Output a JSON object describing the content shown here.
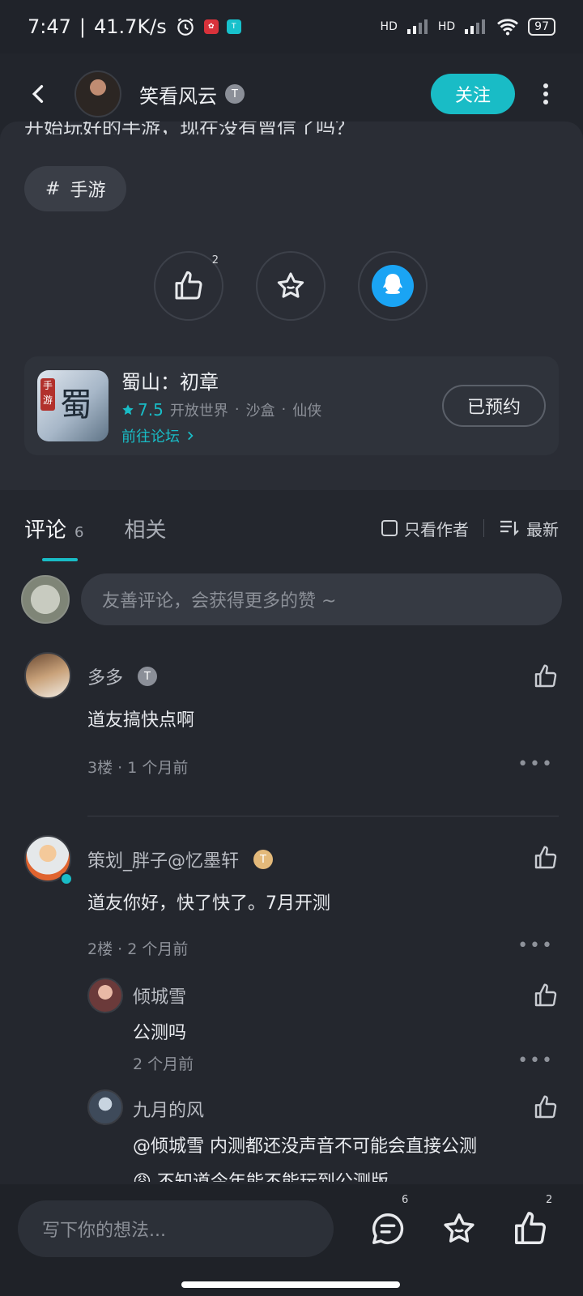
{
  "status_bar": {
    "time": "7:47",
    "speed": "41.7K/s",
    "battery": "97",
    "net1": "HD",
    "net2": "HD"
  },
  "header": {
    "author_name": "笑看风云",
    "badge": "T",
    "follow_label": "关注"
  },
  "post": {
    "cutoff_text": "开始玩好的手游，现在没有曾信了吗？",
    "tag": "手游",
    "like_count": "2"
  },
  "game": {
    "title": "蜀山：初章",
    "score": "7.5",
    "tags": [
      "开放世界",
      "沙盒",
      "仙侠"
    ],
    "link_label": "前往论坛",
    "reserved_label": "已预约",
    "icon_tag": "手游",
    "icon_glyph": "蜀"
  },
  "tabs": {
    "comment_label": "评论",
    "comment_count": "6",
    "related_label": "相关",
    "author_only_label": "只看作者",
    "sort_label": "最新"
  },
  "comment_input": {
    "placeholder": "友善评论，会获得更多的赞 ~"
  },
  "comments": [
    {
      "name": "多多",
      "badge": "T",
      "text": "道友搞快点啊",
      "meta": "3楼 · 1 个月前"
    },
    {
      "name": "策划_胖子@忆墨轩",
      "badge": "T",
      "text": "道友你好，快了快了。7月开测",
      "meta": "2楼 · 2 个月前",
      "replies": [
        {
          "name": "倾城雪",
          "text": "公测吗",
          "meta": "2 个月前"
        },
        {
          "name": "九月的风",
          "text": "@倾城雪  内测都还没声音不可能会直接公测",
          "text2": "😩  不知道今年能不能玩到公测版"
        }
      ]
    }
  ],
  "bottom_bar": {
    "placeholder": "写下你的想法...",
    "comment_count": "6",
    "like_count": "2"
  },
  "colors": {
    "accent": "#19bcc6",
    "background": "#24272e",
    "card": "#2a2d35"
  }
}
